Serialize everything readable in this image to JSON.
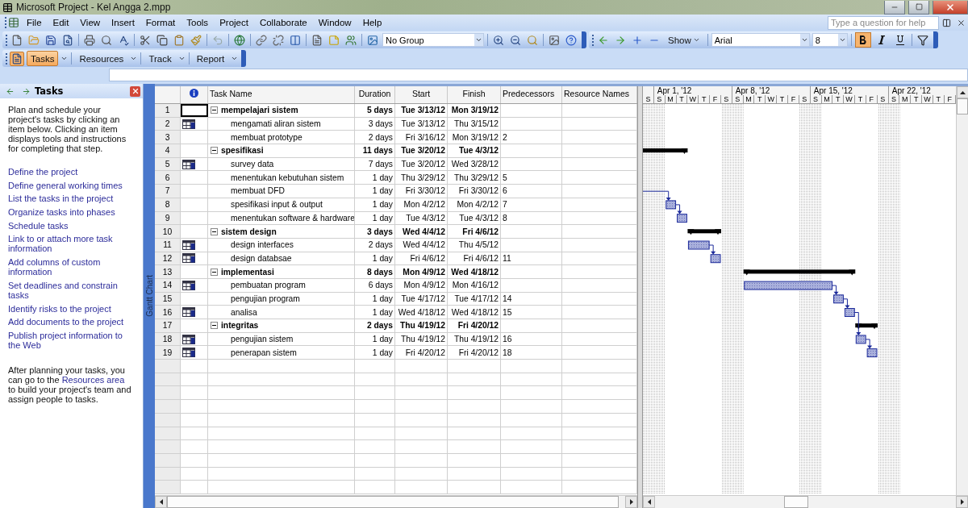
{
  "window": {
    "title": "Microsoft Project - Kel Angga 2.mpp"
  },
  "menu": [
    "File",
    "Edit",
    "View",
    "Insert",
    "Format",
    "Tools",
    "Project",
    "Collaborate",
    "Window",
    "Help"
  ],
  "help_search": {
    "placeholder": "Type a question for help"
  },
  "toolbar": {
    "group_select": "No Group",
    "show_button": "Show",
    "font": "Arial",
    "font_size": "8",
    "bold": true,
    "italic": false,
    "underline": false
  },
  "guide_toolbar": [
    {
      "label": "Tasks",
      "selected": true
    },
    {
      "label": "Resources",
      "selected": false
    },
    {
      "label": "Track",
      "selected": false
    },
    {
      "label": "Report",
      "selected": false
    }
  ],
  "task_pane": {
    "title": "Tasks",
    "intro": "Plan and schedule your project's tasks by clicking an item below. Clicking an item displays tools and instructions for completing that step.",
    "links": [
      "Define the project",
      "Define general working times",
      "List the tasks in the project",
      "Organize tasks into phases",
      "Schedule tasks",
      "Link to or attach more task information",
      "Add columns of custom information",
      "Set deadlines and constrain tasks",
      "Identify risks to the project",
      "Add documents to the project",
      "Publish project information to the Web"
    ],
    "footer": {
      "before": "After planning your tasks, you can go to the",
      "link": "Resources area",
      "after": "to build your project's team and assign people to tasks."
    }
  },
  "view_bar": {
    "label": "Gantt Chart"
  },
  "table": {
    "columns": [
      "Task Name",
      "Duration",
      "Start",
      "Finish",
      "Predecessors",
      "Resource Names"
    ],
    "rows": [
      {
        "id": "1",
        "name": "mempelajari sistem",
        "duration": "5 days",
        "start": "Tue 3/13/12",
        "finish": "Mon 3/19/12",
        "has_indicator": false,
        "selected": true,
        "expanded": true,
        "children": [
          {
            "id": "2",
            "name": "mengamati aliran sistem",
            "duration": "3 days",
            "start": "Tue 3/13/12",
            "finish": "Thu 3/15/12",
            "has_indicator": true,
            "selected": false
          },
          {
            "id": "3",
            "name": "membuat prototype",
            "duration": "2 days",
            "start": "Fri 3/16/12",
            "finish": "Mon 3/19/12",
            "predecessors": "2",
            "has_indicator": false,
            "selected": false
          }
        ]
      },
      {
        "id": "4",
        "name": "spesifikasi",
        "duration": "11 days",
        "start": "Tue 3/20/12",
        "finish": "Tue 4/3/12",
        "has_indicator": false,
        "selected": false,
        "expanded": true,
        "children": [
          {
            "id": "5",
            "name": "survey data",
            "duration": "7 days",
            "start": "Tue 3/20/12",
            "finish": "Wed 3/28/12",
            "has_indicator": true,
            "selected": false
          },
          {
            "id": "6",
            "name": "menentukan kebutuhan sistem",
            "duration": "1 day",
            "start": "Thu 3/29/12",
            "finish": "Thu 3/29/12",
            "predecessors": "5",
            "has_indicator": false,
            "selected": false
          },
          {
            "id": "7",
            "name": "membuat DFD",
            "duration": "1 day",
            "start": "Fri 3/30/12",
            "finish": "Fri 3/30/12",
            "predecessors": "6",
            "has_indicator": false,
            "selected": false
          },
          {
            "id": "8",
            "name": "spesifikasi input & output",
            "duration": "1 day",
            "start": "Mon 4/2/12",
            "finish": "Mon 4/2/12",
            "predecessors": "7",
            "has_indicator": false,
            "selected": false
          },
          {
            "id": "9",
            "name": "menentukan software & hardware",
            "duration": "1 day",
            "start": "Tue 4/3/12",
            "finish": "Tue 4/3/12",
            "predecessors": "8",
            "has_indicator": false,
            "selected": false
          }
        ]
      },
      {
        "id": "10",
        "name": "sistem design",
        "duration": "3 days",
        "start": "Wed 4/4/12",
        "finish": "Fri 4/6/12",
        "has_indicator": false,
        "selected": false,
        "expanded": true,
        "children": [
          {
            "id": "11",
            "name": "design interfaces",
            "duration": "2 days",
            "start": "Wed 4/4/12",
            "finish": "Thu 4/5/12",
            "has_indicator": true,
            "selected": false
          },
          {
            "id": "12",
            "name": "design databsae",
            "duration": "1 day",
            "start": "Fri 4/6/12",
            "finish": "Fri 4/6/12",
            "predecessors": "11",
            "has_indicator": true,
            "selected": false
          }
        ]
      },
      {
        "id": "13",
        "name": "implementasi",
        "duration": "8 days",
        "start": "Mon 4/9/12",
        "finish": "Wed 4/18/12",
        "has_indicator": false,
        "selected": false,
        "expanded": true,
        "children": [
          {
            "id": "14",
            "name": "pembuatan program",
            "duration": "6 days",
            "start": "Mon 4/9/12",
            "finish": "Mon 4/16/12",
            "has_indicator": true,
            "selected": false
          },
          {
            "id": "15",
            "name": "pengujian program",
            "duration": "1 day",
            "start": "Tue 4/17/12",
            "finish": "Tue 4/17/12",
            "predecessors": "14",
            "has_indicator": false,
            "selected": false
          },
          {
            "id": "16",
            "name": "analisa",
            "duration": "1 day",
            "start": "Wed 4/18/12",
            "finish": "Wed 4/18/12",
            "predecessors": "15",
            "has_indicator": true,
            "selected": false
          }
        ]
      },
      {
        "id": "17",
        "name": "integritas",
        "duration": "2 days",
        "start": "Thu 4/19/12",
        "finish": "Fri 4/20/12",
        "has_indicator": false,
        "selected": false,
        "expanded": true,
        "children": [
          {
            "id": "18",
            "name": "pengujian sistem",
            "duration": "1 day",
            "start": "Thu 4/19/12",
            "finish": "Thu 4/19/12",
            "predecessors": "16",
            "has_indicator": true,
            "selected": false
          },
          {
            "id": "19",
            "name": "penerapan sistem",
            "duration": "1 day",
            "start": "Fri 4/20/12",
            "finish": "Fri 4/20/12",
            "predecessors": "18",
            "has_indicator": true,
            "selected": false
          }
        ]
      }
    ]
  },
  "timescale": {
    "weeks": [
      "Apr 1, '12",
      "Apr 8, '12",
      "Apr 15, '12",
      "Apr 22, '12"
    ],
    "days": [
      "S",
      "S",
      "M",
      "T",
      "W",
      "T",
      "F",
      "S",
      "S",
      "M",
      "T",
      "W",
      "T",
      "F",
      "S",
      "S",
      "M",
      "T",
      "W",
      "T",
      "F",
      "S",
      "S",
      "M",
      "T",
      "W",
      "T",
      "F"
    ]
  }
}
